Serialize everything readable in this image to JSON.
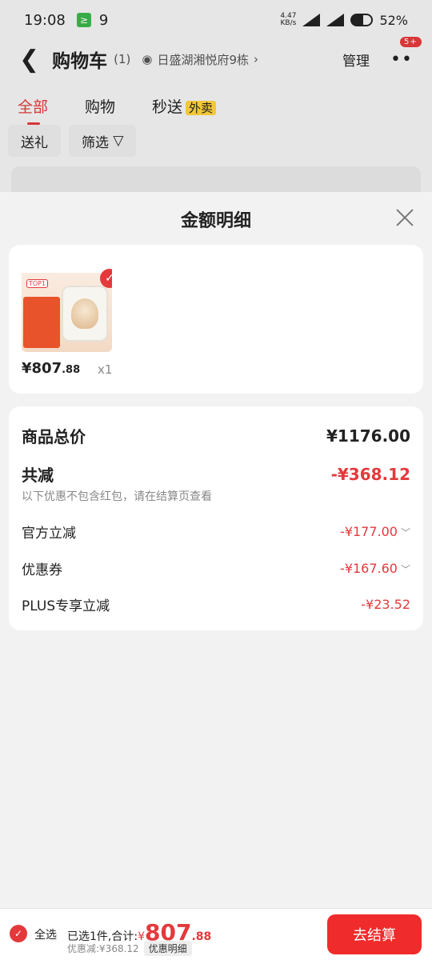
{
  "status_bar": {
    "time": "19:08",
    "notif_icon_text": "9",
    "net_speed_top": "4.47",
    "net_speed_bottom": "KB/s",
    "battery": "52%"
  },
  "header": {
    "title": "购物车",
    "count": "(1)",
    "address": "日盛湖湘悦府9栋",
    "manage": "管理",
    "badge": "5+"
  },
  "tabs": [
    {
      "label": "全部"
    },
    {
      "label": "购物"
    },
    {
      "label": "秒送"
    }
  ],
  "tab_tag": "外卖",
  "chips": {
    "gift": "送礼",
    "filter": "筛选"
  },
  "sheet": {
    "title": "金额明细",
    "item": {
      "price_int": "¥807",
      "price_dec": ".88",
      "qty": "x1",
      "thumb_tag": "TOP1"
    },
    "details": {
      "total_label": "商品总价",
      "total_value": "¥1176.00",
      "reduce_label": "共减",
      "reduce_value": "-¥368.12",
      "note": "以下优惠不包含红包，请在结算页查看",
      "official_label": "官方立减",
      "official_value": "-¥177.00",
      "coupon_label": "优惠券",
      "coupon_value": "-¥167.60",
      "plus_label": "PLUS专享立减",
      "plus_value": "-¥23.52"
    }
  },
  "bottom": {
    "select_all": "全选",
    "selected_text": "已选1件,合计:",
    "currency": "¥",
    "total_int": "807",
    "total_dec": ".88",
    "saved_text": "优惠减:¥368.12",
    "detail_btn": "优惠明细",
    "checkout": "去结算"
  },
  "colors": {
    "accent": "#e4393c",
    "checkout_bg": "#f02b2b",
    "tag_yellow": "#ffd23c"
  }
}
